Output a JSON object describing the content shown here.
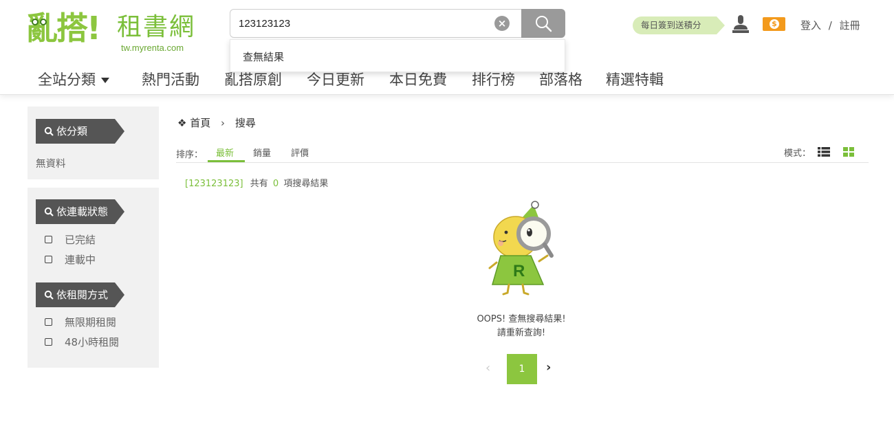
{
  "header": {
    "logo": {
      "main": "亂搭!",
      "sub": "租書網",
      "url": "tw.myrenta.com"
    },
    "search": {
      "value": "123123123",
      "suggestion": "查無結果"
    },
    "checkin_label": "每日簽到送積分",
    "login_label": "登入",
    "auth_sep": "/",
    "register_label": "註冊",
    "coin_symbol": "$"
  },
  "nav": {
    "items": [
      {
        "label": "全站分類"
      },
      {
        "label": "熱門活動"
      },
      {
        "label": "亂搭原創"
      },
      {
        "label": "今日更新"
      },
      {
        "label": "本日免費"
      },
      {
        "label": "排行榜"
      },
      {
        "label": "部落格"
      },
      {
        "label": "精選特輯"
      }
    ]
  },
  "sidebar": {
    "category": {
      "title": "依分類",
      "empty": "無資料"
    },
    "status": {
      "title": "依連載狀態",
      "options": [
        "已完結",
        "連載中"
      ]
    },
    "rent": {
      "title": "依租閱方式",
      "options": [
        "無限期租閱",
        "48小時租閱"
      ]
    }
  },
  "breadcrumb": {
    "home": "首頁",
    "sep": "›",
    "current": "搜尋"
  },
  "sort": {
    "label": "排序：",
    "options": [
      "最新",
      "銷量",
      "評價"
    ],
    "active": "最新",
    "mode_label": "模式："
  },
  "result": {
    "query": "[123123123]",
    "prefix": "共有",
    "count": "0",
    "suffix": "項搜尋結果"
  },
  "empty": {
    "line1": "OOPS! 查無搜尋結果!",
    "line2": "請重新查詢!"
  },
  "pagination": {
    "prev": "‹",
    "current": "1",
    "next": "›"
  },
  "colors": {
    "brand_green": "#8cc63f",
    "accent_orange": "#f39a1c",
    "tag_gray": "#555555"
  }
}
